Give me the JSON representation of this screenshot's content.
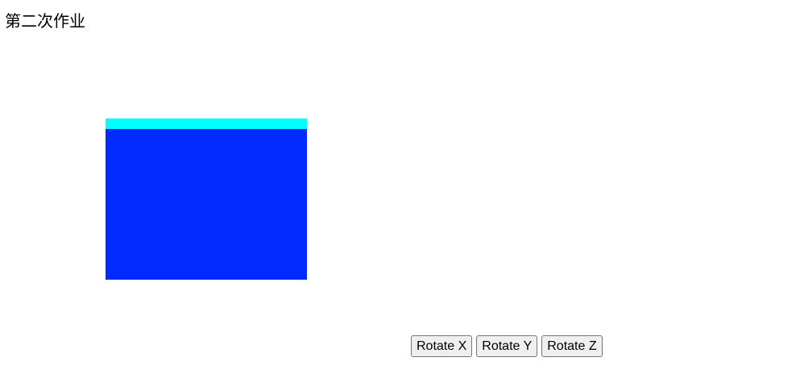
{
  "page": {
    "title": "第二次作业"
  },
  "canvas": {
    "cube_top_color": "#00ffff",
    "cube_front_color": "#002aff"
  },
  "controls": {
    "rotate_x_label": "Rotate X",
    "rotate_y_label": "Rotate Y",
    "rotate_z_label": "Rotate Z"
  }
}
